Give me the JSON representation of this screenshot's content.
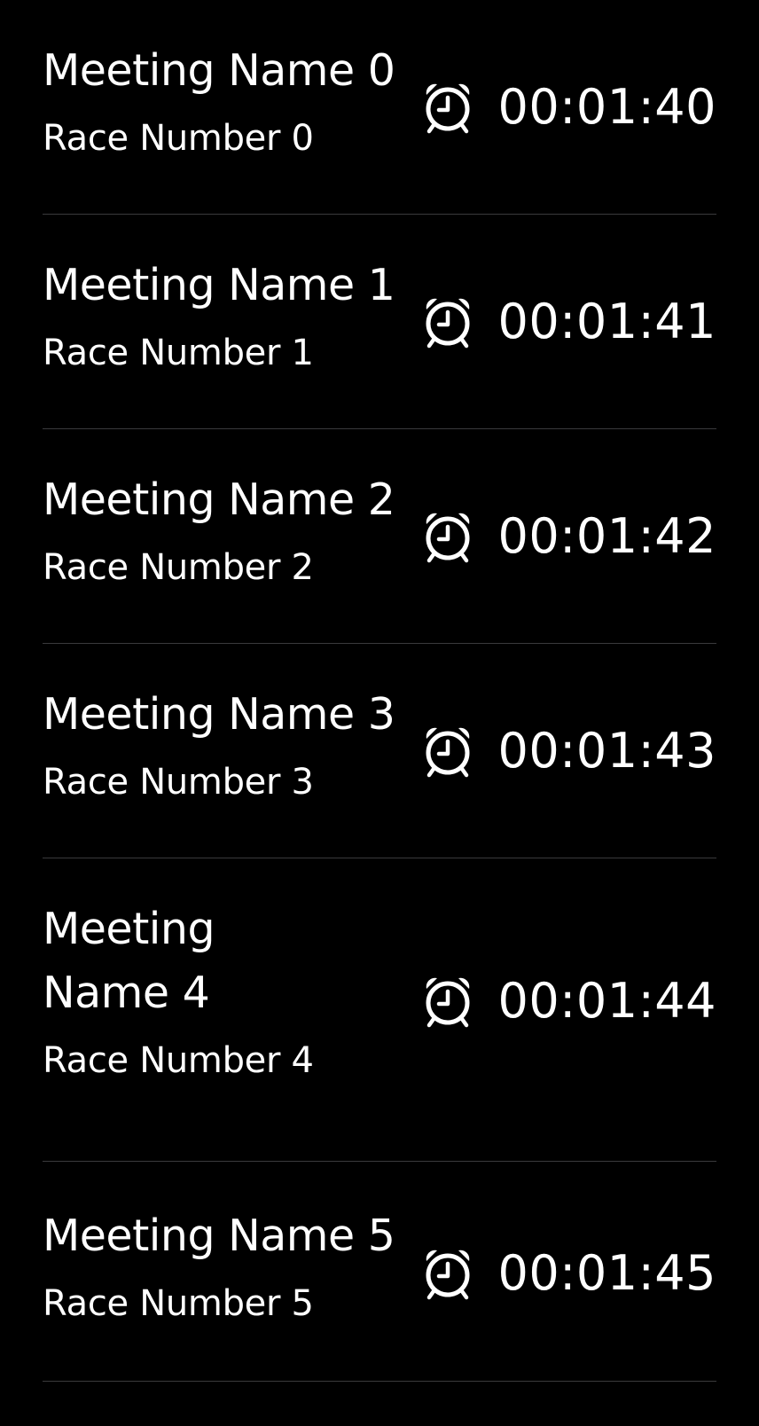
{
  "races": [
    {
      "meeting": "Meeting Name 0",
      "race": "Race Number 0",
      "countdown": "00:01:40",
      "icon": "alarm-clock-icon"
    },
    {
      "meeting": "Meeting Name 1",
      "race": "Race Number 1",
      "countdown": "00:01:41",
      "icon": "alarm-clock-icon"
    },
    {
      "meeting": "Meeting Name 2",
      "race": "Race Number 2",
      "countdown": "00:01:42",
      "icon": "alarm-clock-icon"
    },
    {
      "meeting": "Meeting Name 3",
      "race": "Race Number 3",
      "countdown": "00:01:43",
      "icon": "alarm-clock-icon"
    },
    {
      "meeting": "Meeting Name 4",
      "race": "Race Number 4",
      "countdown": "00:01:44",
      "icon": "alarm-clock-icon"
    },
    {
      "meeting": "Meeting Name 5",
      "race": "Race Number 5",
      "countdown": "00:01:45",
      "icon": "alarm-clock-icon"
    }
  ],
  "colors": {
    "background": "#000000",
    "text": "#ffffff",
    "separator": "#3a3a3c"
  }
}
